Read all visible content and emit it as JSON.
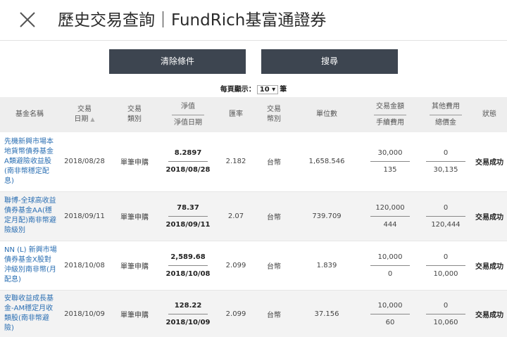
{
  "header": {
    "title": "歷史交易查詢｜FundRich基富通證券"
  },
  "buttons": {
    "clear": "清除條件",
    "search": "搜尋"
  },
  "pagination": {
    "label": "每頁顯示：",
    "value": "10 ▾",
    "suffix": "筆"
  },
  "table": {
    "headers": {
      "fund_name": "基金名稱",
      "trade_date_1": "交易",
      "trade_date_2": "日期",
      "trade_type_1": "交易",
      "trade_type_2": "類別",
      "nav_1": "淨值",
      "nav_2": "淨值日期",
      "fx": "匯率",
      "currency_1": "交易",
      "currency_2": "幣別",
      "units": "單位數",
      "amount_1": "交易金額",
      "amount_2": "手續費用",
      "other_1": "其他費用",
      "other_2": "總價金",
      "status": "狀態"
    },
    "rows": [
      {
        "fund": "先機新興市場本地貨幣債券基金A類避險收益股(南非幣穩定配息)",
        "date": "2018/08/28",
        "type": "單筆申購",
        "nav": "8.2897",
        "nav_date": "2018/08/28",
        "fx": "2.182",
        "currency": "台幣",
        "units": "1,658.546",
        "amount": "30,000",
        "fee": "135",
        "other": "0",
        "total": "30,135",
        "status": "交易成功"
      },
      {
        "fund": "聯博-全球高收益債券基金AA(穩定月配)南非幣避險級別",
        "date": "2018/09/11",
        "type": "單筆申購",
        "nav": "78.37",
        "nav_date": "2018/09/11",
        "fx": "2.07",
        "currency": "台幣",
        "units": "739.709",
        "amount": "120,000",
        "fee": "444",
        "other": "0",
        "total": "120,444",
        "status": "交易成功"
      },
      {
        "fund": "NN (L) 新興市場債券基金X股對沖級別南非幣(月配息)",
        "date": "2018/10/08",
        "type": "單筆申購",
        "nav": "2,589.68",
        "nav_date": "2018/10/08",
        "fx": "2.099",
        "currency": "台幣",
        "units": "1.839",
        "amount": "10,000",
        "fee": "0",
        "other": "0",
        "total": "10,000",
        "status": "交易成功"
      },
      {
        "fund": "安聯收益成長基金-AM穩定月收類股(南非幣避險)",
        "date": "2018/10/09",
        "type": "單筆申購",
        "nav": "128.22",
        "nav_date": "2018/10/09",
        "fx": "2.099",
        "currency": "台幣",
        "units": "37.156",
        "amount": "10,000",
        "fee": "60",
        "other": "0",
        "total": "10,060",
        "status": "交易成功"
      }
    ]
  }
}
